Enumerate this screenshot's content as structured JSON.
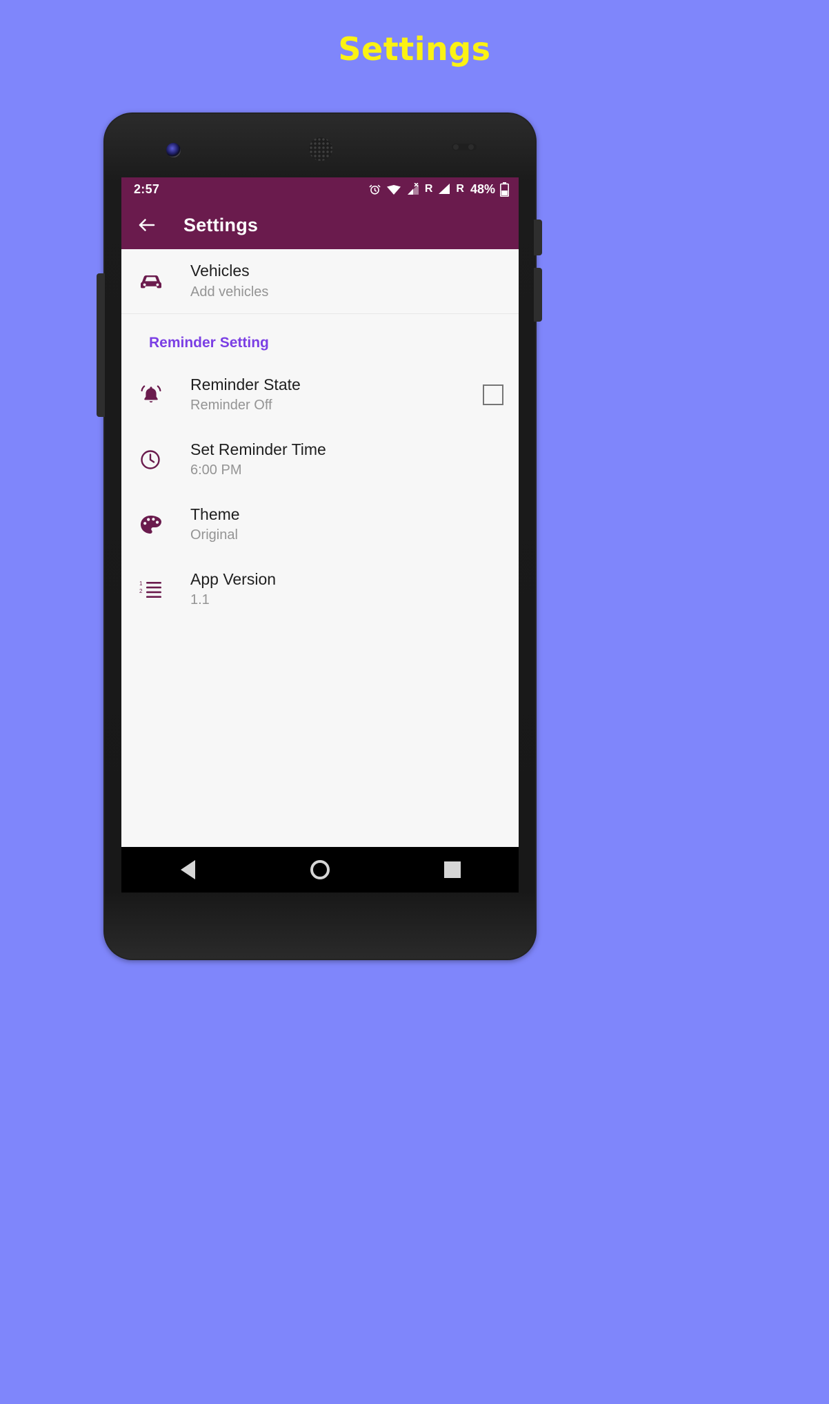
{
  "page": {
    "title": "Settings",
    "background_color": "#7f86fb",
    "title_color": "#fbf213"
  },
  "device": {
    "body_color": "#232323",
    "screen_background": "#f7f7f7"
  },
  "status_bar": {
    "time": "2:57",
    "background_color": "#6a1b4d",
    "icons": [
      "alarm-icon",
      "wifi-icon",
      "mobile-signal-off-icon",
      "roaming-letter",
      "mobile-signal-icon",
      "roaming-letter-2",
      "battery-icon"
    ],
    "roaming_label_1": "R",
    "roaming_label_2": "R",
    "battery_percent": "48%"
  },
  "app_bar": {
    "back_label": "Back",
    "title": "Settings",
    "background_color": "#6a1b4d",
    "text_color": "#ffffff"
  },
  "settings": {
    "accent_color": "#6a1b4d",
    "section_header_color": "#7b3fe4",
    "top_items": [
      {
        "icon": "car-icon",
        "title": "Vehicles",
        "subtitle": "Add vehicles"
      }
    ],
    "section_header": "Reminder Setting",
    "items": [
      {
        "icon": "bell-icon",
        "title": "Reminder State",
        "subtitle": "Reminder Off",
        "control": "checkbox",
        "checked": false
      },
      {
        "icon": "clock-icon",
        "title": "Set Reminder Time",
        "subtitle": "6:00 PM",
        "control": "none"
      },
      {
        "icon": "palette-icon",
        "title": "Theme",
        "subtitle": "Original",
        "control": "none"
      },
      {
        "icon": "list-icon",
        "title": "App Version",
        "subtitle": "1.1",
        "control": "none"
      }
    ]
  },
  "nav_bar": {
    "back_label": "Back",
    "home_label": "Home",
    "recents_label": "Recents"
  }
}
